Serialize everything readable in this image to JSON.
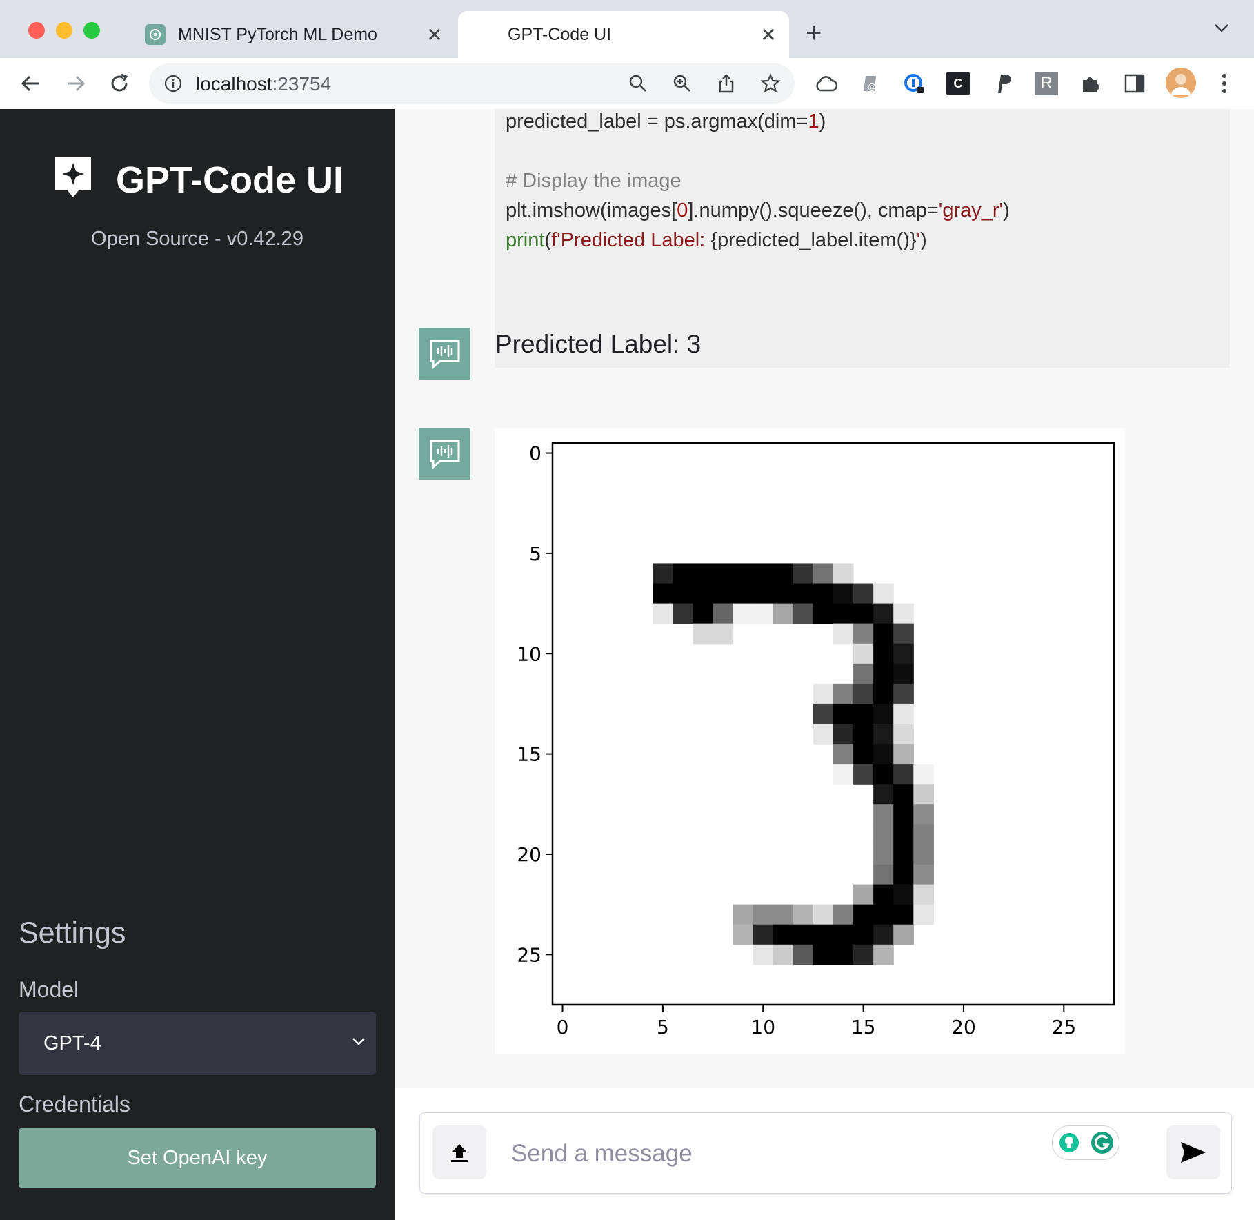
{
  "browser": {
    "tabs": [
      {
        "title": "MNIST PyTorch ML Demo",
        "active": false
      },
      {
        "title": "GPT-Code UI",
        "active": true
      }
    ],
    "url_host": "localhost",
    "url_port": ":23754",
    "extension_c_label": "C",
    "extension_r_label": "R"
  },
  "sidebar": {
    "title": "GPT-Code UI",
    "subtitle": "Open Source - v0.42.29",
    "settings_title": "Settings",
    "model_label": "Model",
    "model_value": "GPT-4",
    "credentials_label": "Credentials",
    "set_key_label": "Set OpenAI key"
  },
  "code": {
    "line1_a": "predicted_label = ps.argmax(dim=",
    "line1_num": "1",
    "line1_b": ")",
    "comment": "# Display the image",
    "line3_a": "plt.imshow(images[",
    "line3_num": "0",
    "line3_b": "].numpy().squeeze(), cmap=",
    "line3_str": "'gray_r'",
    "line3_c": ")",
    "line4_builtin": "print",
    "line4_a": "(",
    "line4_str1": "f'Predicted Label: ",
    "line4_b": "{predicted_label.item()}",
    "line4_str2": "'",
    "line4_c": ")"
  },
  "messages": {
    "result_text": "Predicted Label: 3"
  },
  "input": {
    "placeholder": "Send a message"
  },
  "colors": {
    "sidebar_bg": "#202123",
    "accent": "#74aa9c",
    "button_bg": "#7da899"
  },
  "chart_data": {
    "type": "heatmap",
    "cmap": "gray_r",
    "x_ticks": [
      0,
      5,
      10,
      15,
      20,
      25
    ],
    "y_ticks": [
      0,
      5,
      10,
      15,
      20,
      25
    ],
    "x_tick_labels": [
      "0",
      "5",
      "10",
      "15",
      "20",
      "25"
    ],
    "y_tick_labels": [
      "0",
      "5",
      "10",
      "15",
      "20",
      "25"
    ],
    "xlim": [
      -0.5,
      27.5
    ],
    "ylim": [
      27.5,
      -0.5
    ],
    "size": [
      28,
      28
    ],
    "pixels": [
      [
        5,
        6,
        0.85
      ],
      [
        6,
        6,
        1
      ],
      [
        7,
        6,
        1
      ],
      [
        8,
        6,
        1
      ],
      [
        9,
        6,
        1
      ],
      [
        10,
        6,
        1
      ],
      [
        11,
        6,
        1
      ],
      [
        12,
        6,
        0.8
      ],
      [
        13,
        6,
        0.55
      ],
      [
        14,
        6,
        0.15
      ],
      [
        5,
        7,
        1
      ],
      [
        6,
        7,
        1
      ],
      [
        7,
        7,
        1
      ],
      [
        8,
        7,
        1
      ],
      [
        9,
        7,
        1
      ],
      [
        10,
        7,
        1
      ],
      [
        11,
        7,
        1
      ],
      [
        12,
        7,
        1
      ],
      [
        13,
        7,
        1
      ],
      [
        14,
        7,
        0.95
      ],
      [
        15,
        7,
        0.8
      ],
      [
        16,
        7,
        0.1
      ],
      [
        5,
        8,
        0.1
      ],
      [
        6,
        8,
        0.8
      ],
      [
        7,
        8,
        1
      ],
      [
        8,
        8,
        0.6
      ],
      [
        9,
        8,
        0.05
      ],
      [
        10,
        8,
        0.05
      ],
      [
        11,
        8,
        0.35
      ],
      [
        12,
        8,
        0.7
      ],
      [
        13,
        8,
        1
      ],
      [
        14,
        8,
        1
      ],
      [
        15,
        8,
        1
      ],
      [
        16,
        8,
        0.9
      ],
      [
        17,
        8,
        0.1
      ],
      [
        7,
        9,
        0.15
      ],
      [
        8,
        9,
        0.15
      ],
      [
        14,
        9,
        0.1
      ],
      [
        15,
        9,
        0.5
      ],
      [
        16,
        9,
        1
      ],
      [
        17,
        9,
        0.75
      ],
      [
        15,
        10,
        0.15
      ],
      [
        16,
        10,
        1
      ],
      [
        17,
        10,
        0.9
      ],
      [
        15,
        11,
        0.55
      ],
      [
        16,
        11,
        1
      ],
      [
        17,
        11,
        0.95
      ],
      [
        13,
        12,
        0.1
      ],
      [
        14,
        12,
        0.5
      ],
      [
        15,
        12,
        0.75
      ],
      [
        16,
        12,
        1
      ],
      [
        17,
        12,
        0.75
      ],
      [
        13,
        13,
        0.75
      ],
      [
        14,
        13,
        1
      ],
      [
        15,
        13,
        1
      ],
      [
        16,
        13,
        0.95
      ],
      [
        17,
        13,
        0.1
      ],
      [
        13,
        14,
        0.1
      ],
      [
        14,
        14,
        0.85
      ],
      [
        15,
        14,
        1
      ],
      [
        16,
        14,
        0.9
      ],
      [
        17,
        14,
        0.15
      ],
      [
        14,
        15,
        0.5
      ],
      [
        15,
        15,
        1
      ],
      [
        16,
        15,
        0.95
      ],
      [
        17,
        15,
        0.3
      ],
      [
        14,
        16,
        0.05
      ],
      [
        15,
        16,
        0.75
      ],
      [
        16,
        16,
        1
      ],
      [
        17,
        16,
        0.8
      ],
      [
        18,
        16,
        0.05
      ],
      [
        16,
        17,
        0.9
      ],
      [
        17,
        17,
        1
      ],
      [
        18,
        17,
        0.2
      ],
      [
        16,
        18,
        0.5
      ],
      [
        17,
        18,
        1
      ],
      [
        18,
        18,
        0.45
      ],
      [
        16,
        19,
        0.5
      ],
      [
        17,
        19,
        1
      ],
      [
        18,
        19,
        0.5
      ],
      [
        16,
        20,
        0.5
      ],
      [
        17,
        20,
        1
      ],
      [
        18,
        20,
        0.5
      ],
      [
        16,
        21,
        0.55
      ],
      [
        17,
        21,
        1
      ],
      [
        18,
        21,
        0.45
      ],
      [
        15,
        22,
        0.35
      ],
      [
        16,
        22,
        1
      ],
      [
        17,
        22,
        0.95
      ],
      [
        18,
        22,
        0.15
      ],
      [
        9,
        23,
        0.35
      ],
      [
        10,
        23,
        0.45
      ],
      [
        11,
        23,
        0.45
      ],
      [
        12,
        23,
        0.3
      ],
      [
        13,
        23,
        0.15
      ],
      [
        14,
        23,
        0.5
      ],
      [
        15,
        23,
        1
      ],
      [
        16,
        23,
        1
      ],
      [
        17,
        23,
        1
      ],
      [
        18,
        23,
        0.1
      ],
      [
        9,
        24,
        0.3
      ],
      [
        10,
        24,
        0.85
      ],
      [
        11,
        24,
        1
      ],
      [
        12,
        24,
        1
      ],
      [
        13,
        24,
        1
      ],
      [
        14,
        24,
        1
      ],
      [
        15,
        24,
        1
      ],
      [
        16,
        24,
        0.9
      ],
      [
        17,
        24,
        0.35
      ],
      [
        10,
        25,
        0.1
      ],
      [
        11,
        25,
        0.2
      ],
      [
        12,
        25,
        0.65
      ],
      [
        13,
        25,
        1
      ],
      [
        14,
        25,
        1
      ],
      [
        15,
        25,
        0.85
      ],
      [
        16,
        25,
        0.3
      ]
    ]
  }
}
